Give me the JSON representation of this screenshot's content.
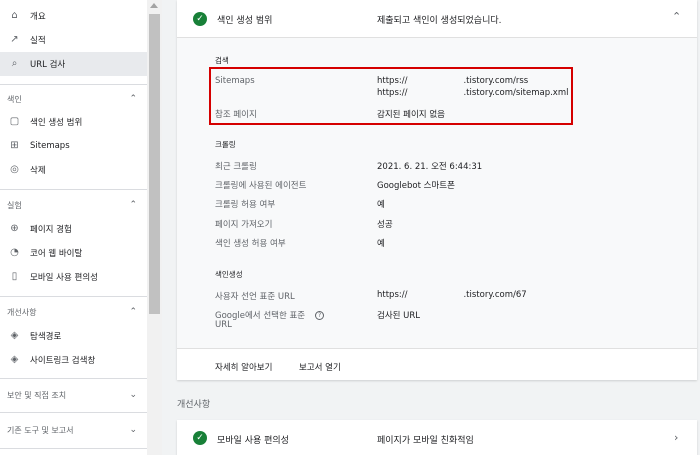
{
  "sidebar": {
    "items": [
      {
        "label": "개요",
        "icon": "home-icon",
        "glyph": "⌂"
      },
      {
        "label": "실적",
        "icon": "trend-icon",
        "glyph": "↗"
      },
      {
        "label": "URL 검사",
        "icon": "search-icon",
        "glyph": "⌕"
      }
    ],
    "sections": [
      {
        "label": "색인",
        "items": [
          {
            "label": "색인 생성 범위",
            "icon": "file-icon",
            "glyph": "▢"
          },
          {
            "label": "Sitemaps",
            "icon": "sitemap-icon",
            "glyph": "⊞"
          },
          {
            "label": "삭제",
            "icon": "eye-off-icon",
            "glyph": "◎"
          }
        ]
      },
      {
        "label": "실험",
        "items": [
          {
            "label": "페이지 경험",
            "icon": "plus-circle-icon",
            "glyph": "⊕"
          },
          {
            "label": "코어 웹 바이탈",
            "icon": "gauge-icon",
            "glyph": "◔"
          },
          {
            "label": "모바일 사용 편의성",
            "icon": "phone-icon",
            "glyph": "▯"
          }
        ]
      },
      {
        "label": "개선사항",
        "items": [
          {
            "label": "탐색경로",
            "icon": "layers-icon",
            "glyph": "◈"
          },
          {
            "label": "사이트링크 검색창",
            "icon": "layers-icon",
            "glyph": "◈"
          }
        ]
      },
      {
        "label": "보안 및 직접 조치",
        "items": []
      },
      {
        "label": "기존 도구 및 보고서",
        "items": []
      }
    ]
  },
  "card": {
    "title": "색인 생성 범위",
    "status": "제출되고 색인이 생성되었습니다.",
    "groups": {
      "discovery": "검색",
      "crawl": "크롤링",
      "indexing": "색인생성"
    },
    "rows": {
      "sitemaps_label": "Sitemaps",
      "sitemap_prefix_1": "https://",
      "sitemap_suffix_1": ".tistory.com/rss",
      "sitemap_prefix_2": "https://",
      "sitemap_suffix_2": ".tistory.com/sitemap.xml",
      "referrer_label": "참조 페이지",
      "referrer_value": "감지된 페이지 없음",
      "last_crawl_label": "최근 크롤링",
      "last_crawl_value": "2021. 6. 21. 오전 6:44:31",
      "agent_label": "크롤링에 사용된 에이전트",
      "agent_value": "Googlebot 스마트폰",
      "crawl_allowed_label": "크롤링 허용 여부",
      "crawl_allowed_value": "예",
      "fetch_label": "페이지 가져오기",
      "fetch_value": "성공",
      "index_allowed_label": "색인 생성 허용 여부",
      "index_allowed_value": "예",
      "user_canonical_label": "사용자 선언 표준 URL",
      "user_canonical_prefix": "https://",
      "user_canonical_suffix": ".tistory.com/67",
      "google_canonical_label_1": "Google에서 선택한 표준",
      "google_canonical_label_2": "URL",
      "google_canonical_value": "검사된 URL"
    },
    "footer": {
      "learn_more": "자세히 알아보기",
      "open_report": "보고서 열기"
    }
  },
  "enhancements": {
    "section_label": "개선사항",
    "mobile_title": "모바일 사용 편의성",
    "mobile_status": "페이지가 모바일 친화적임"
  },
  "colors": {
    "accent_green": "#188038",
    "highlight_red": "#d50000"
  }
}
